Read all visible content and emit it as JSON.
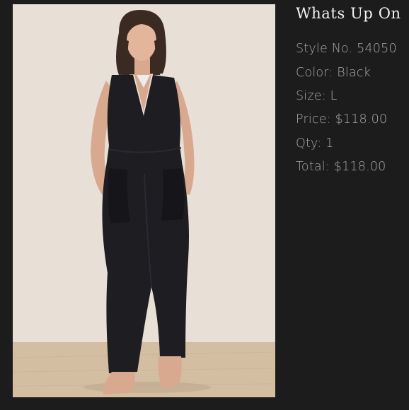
{
  "product": {
    "title": "Whats Up On",
    "style": "Style No. 54050",
    "color": "Color: Black",
    "size": "Size: L",
    "price": "Price: $118.00",
    "qty": "Qty: 1",
    "total": "Total: $118.00"
  },
  "photo": {
    "subject": "model-wearing-black-jumpsuit"
  },
  "colors": {
    "background": "#1c1c1d",
    "title_text": "#f2f2f2",
    "detail_text": "#a8a8a8",
    "garment": "#1e1d22",
    "photo_wall": "#e8e0d6",
    "photo_floor": "#d3bea2"
  }
}
